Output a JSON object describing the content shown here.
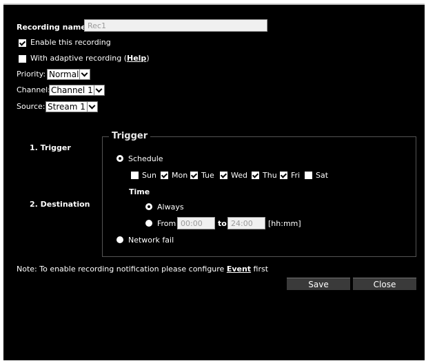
{
  "form": {
    "recording_name_label": "Recording name:",
    "recording_name_value": "Rec1",
    "enable_label": "Enable this recording",
    "enable_checked": true,
    "adaptive_label_prefix": "With adaptive recording (",
    "adaptive_help_link": "Help",
    "adaptive_label_suffix": ")",
    "adaptive_checked": false,
    "priority_label": "Priority:",
    "priority_value": "Normal",
    "channel_label": "Channel:",
    "channel_value": "Channel 1",
    "source_label": "Source:",
    "source_value": "Stream 1"
  },
  "steps": {
    "trigger": "1.  Trigger",
    "destination": "2.  Destination"
  },
  "trigger": {
    "legend": "Trigger",
    "schedule_label": "Schedule",
    "schedule_selected": true,
    "days": [
      {
        "label": "Sun",
        "checked": false
      },
      {
        "label": "Mon",
        "checked": true
      },
      {
        "label": "Tue",
        "checked": true
      },
      {
        "label": "Wed",
        "checked": true
      },
      {
        "label": "Thu",
        "checked": true
      },
      {
        "label": "Fri",
        "checked": true
      },
      {
        "label": "Sat",
        "checked": false
      }
    ],
    "time_label": "Time",
    "always_label": "Always",
    "always_selected": true,
    "from_label": "From",
    "from_value": "00:00",
    "to_label": "to",
    "to_value": "24:00",
    "format_label": "[hh:mm]",
    "network_fail_label": "Network fail",
    "network_fail_selected": false
  },
  "note": {
    "prefix": "Note: To enable recording notification please configure ",
    "link": "Event",
    "suffix": " first"
  },
  "buttons": {
    "save": "Save",
    "close": "Close"
  },
  "colors": {
    "background": "#000000",
    "text": "#ffffff",
    "button": "#3a3a3a"
  }
}
